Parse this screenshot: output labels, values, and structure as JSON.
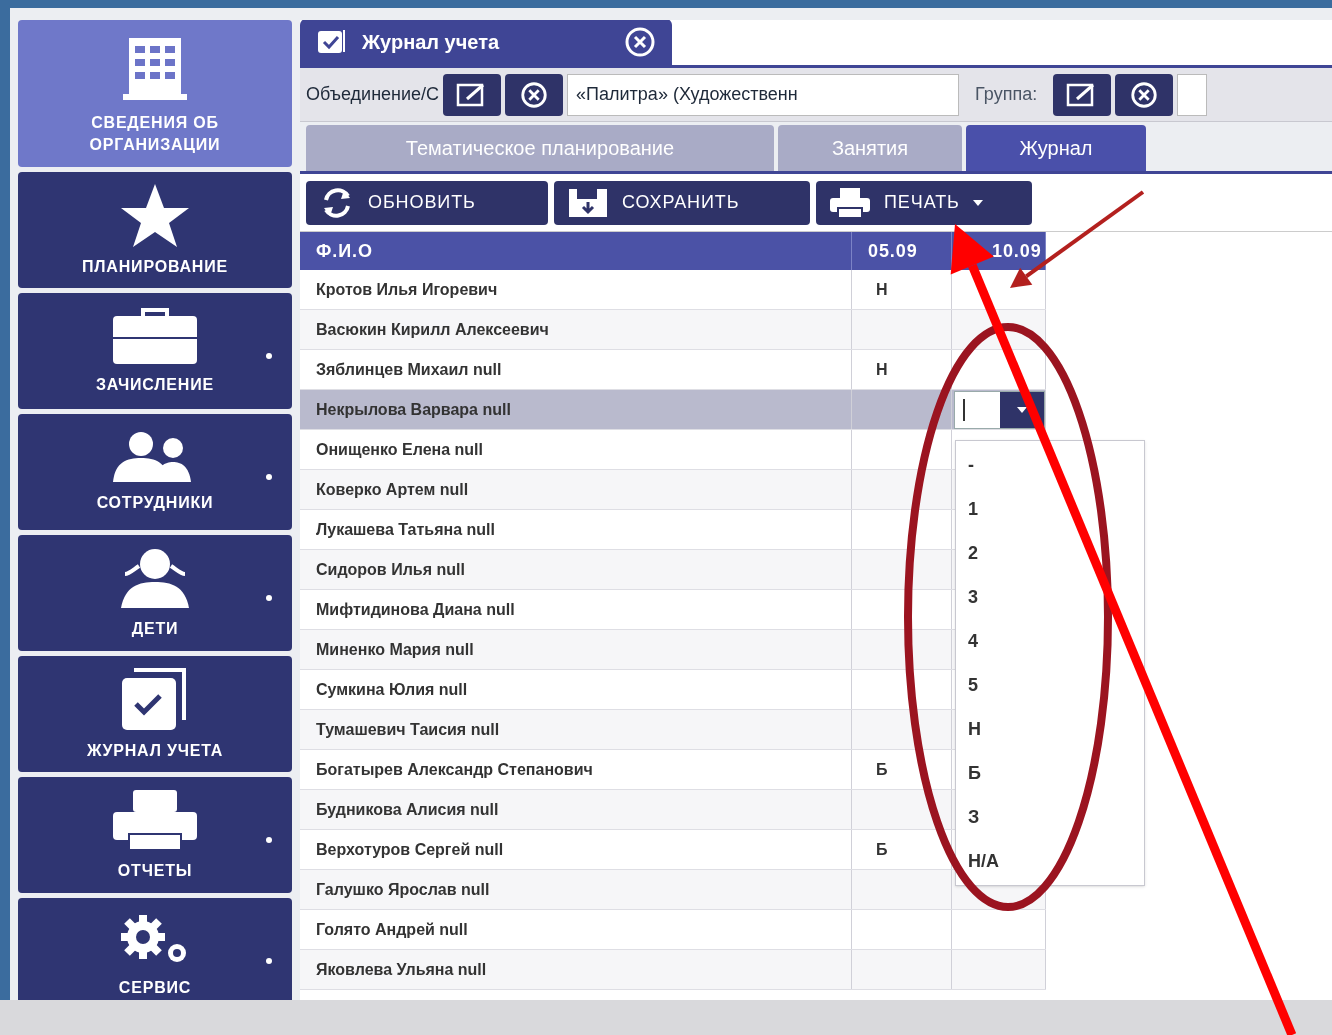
{
  "sidebar": {
    "items": [
      {
        "label": "СВЕДЕНИЯ ОБ ОРГАНИЗАЦИИ",
        "selected": true,
        "submenu": false
      },
      {
        "label": "ПЛАНИРОВАНИЕ",
        "selected": false,
        "submenu": false
      },
      {
        "label": "ЗАЧИСЛЕНИЕ",
        "selected": false,
        "submenu": true
      },
      {
        "label": "СОТРУДНИКИ",
        "selected": false,
        "submenu": true
      },
      {
        "label": "ДЕТИ",
        "selected": false,
        "submenu": true
      },
      {
        "label": "ЖУРНАЛ УЧЕТА",
        "selected": false,
        "submenu": false
      },
      {
        "label": "ОТЧЕТЫ",
        "selected": false,
        "submenu": true
      },
      {
        "label": "СЕРВИС",
        "selected": false,
        "submenu": true
      }
    ]
  },
  "window_tab": {
    "title": "Журнал учета"
  },
  "filters": {
    "association_label": "Объединение/С",
    "association_value": "«Палитра» (Художественн",
    "group_label": "Группа:"
  },
  "tabs": [
    {
      "label": "Тематическое планирование",
      "selected": false
    },
    {
      "label": "Занятия",
      "selected": false
    },
    {
      "label": "Журнал",
      "selected": true
    }
  ],
  "toolbar": [
    {
      "label": "ОБНОВИТЬ",
      "dropdown": false
    },
    {
      "label": "СОХРАНИТЬ",
      "dropdown": false
    },
    {
      "label": "ПЕЧАТЬ",
      "dropdown": true
    }
  ],
  "table": {
    "columns": [
      "Ф.И.О",
      "05.09",
      "10.09"
    ],
    "rows": [
      {
        "name": "Кротов Илья Игоревич",
        "c1": "Н",
        "c2": "",
        "selected": false
      },
      {
        "name": "Васюкин Кирилл Алексеевич",
        "c1": "",
        "c2": "",
        "selected": false
      },
      {
        "name": "Зяблинцев Михаил null",
        "c1": "Н",
        "c2": "",
        "selected": false
      },
      {
        "name": "Некрылова Варвара null",
        "c1": "",
        "c2": "",
        "selected": true
      },
      {
        "name": "Онищенко Елена null",
        "c1": "",
        "c2": "",
        "selected": false
      },
      {
        "name": "Коверко Артем null",
        "c1": "",
        "c2": "",
        "selected": false
      },
      {
        "name": "Лукашева Татьяна null",
        "c1": "",
        "c2": "",
        "selected": false
      },
      {
        "name": "Сидоров Илья null",
        "c1": "",
        "c2": "",
        "selected": false
      },
      {
        "name": "Мифтидинова Диана null",
        "c1": "",
        "c2": "",
        "selected": false
      },
      {
        "name": "Миненко Мария null",
        "c1": "",
        "c2": "",
        "selected": false
      },
      {
        "name": "Сумкина Юлия null",
        "c1": "",
        "c2": "",
        "selected": false
      },
      {
        "name": "Тумашевич Таисия null",
        "c1": "",
        "c2": "",
        "selected": false
      },
      {
        "name": "Богатырев Александр Степанович",
        "c1": "Б",
        "c2": "",
        "selected": false
      },
      {
        "name": "Будникова Алисия null",
        "c1": "",
        "c2": "",
        "selected": false
      },
      {
        "name": "Верхотуров Сергей null",
        "c1": "Б",
        "c2": "",
        "selected": false
      },
      {
        "name": "Галушко Ярослав null",
        "c1": "",
        "c2": "",
        "selected": false
      },
      {
        "name": "Голято Андрей null",
        "c1": "",
        "c2": "",
        "selected": false
      },
      {
        "name": "Яковлева Ульяна null",
        "c1": "",
        "c2": "",
        "selected": false
      }
    ]
  },
  "mark_options": [
    "-",
    "1",
    "2",
    "3",
    "4",
    "5",
    "Н",
    "Б",
    "З",
    "Н/А"
  ],
  "annotations": [
    {
      "kind": "ellipse",
      "color": "#9b1420"
    },
    {
      "kind": "arrow",
      "color": "#b3201e"
    },
    {
      "kind": "arrow",
      "color": "#ff0000"
    }
  ]
}
